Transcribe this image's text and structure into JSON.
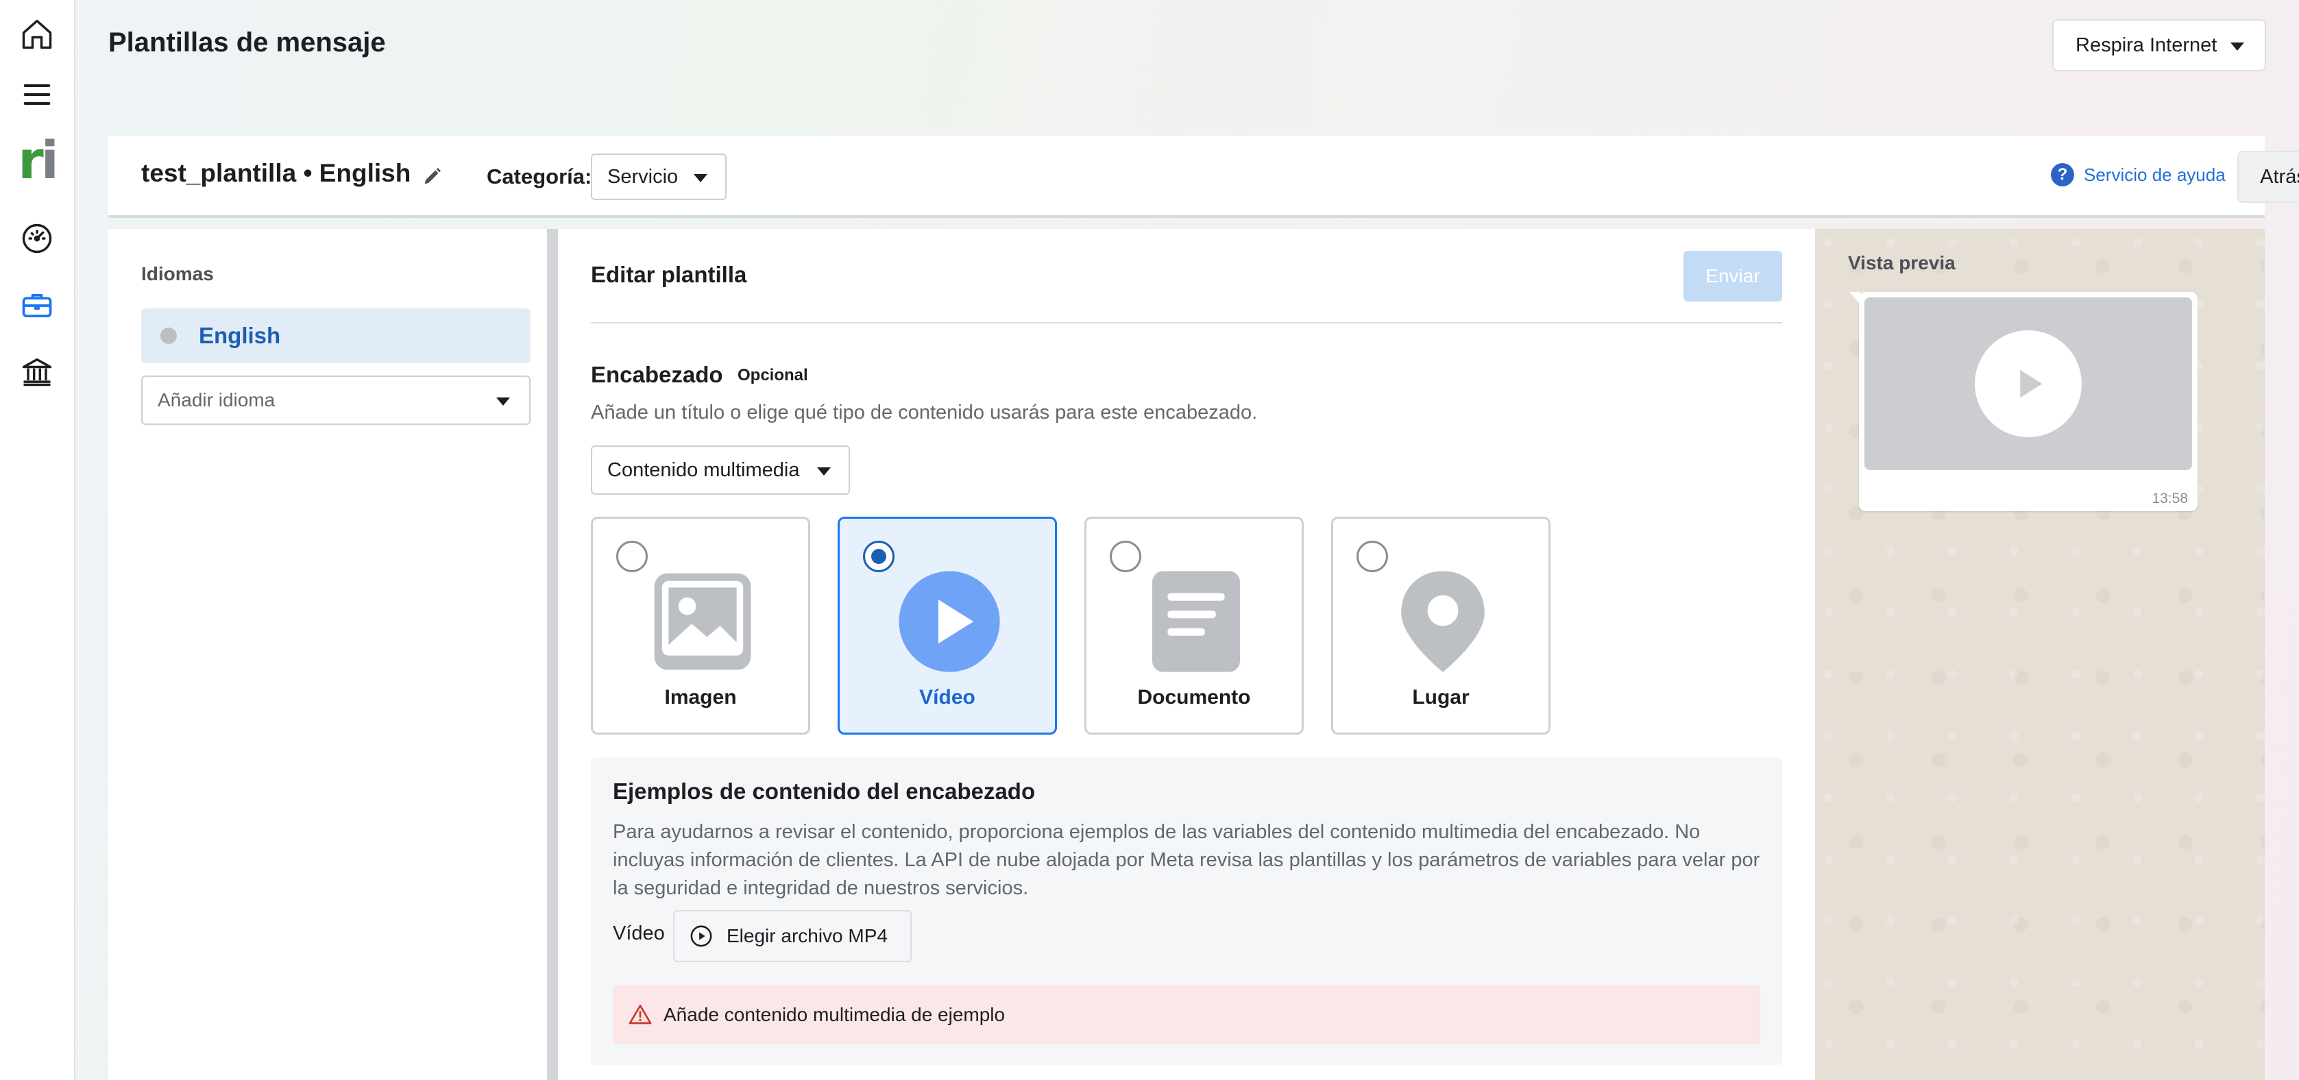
{
  "page": {
    "title": "Plantillas de mensaje",
    "account": "Respira Internet"
  },
  "sidebar": {
    "icons": [
      "home-icon",
      "menu-icon",
      "brand-logo",
      "dashboard-icon",
      "briefcase-icon",
      "bank-icon"
    ],
    "logo_text": "ri"
  },
  "template": {
    "name": "test_plantilla • English",
    "category_label": "Categoría:",
    "category_value": "Servicio",
    "help_label": "Servicio de ayuda",
    "back_label": "Atrás"
  },
  "languages": {
    "title": "Idiomas",
    "items": [
      {
        "label": "English"
      }
    ],
    "add_placeholder": "Añadir idioma"
  },
  "editor": {
    "title": "Editar plantilla",
    "send_label": "Enviar",
    "header": {
      "title": "Encabezado",
      "optional_badge": "Opcional",
      "description": "Añade un título o elige qué tipo de contenido usarás para este encabezado.",
      "type_value": "Contenido multimedia",
      "options": [
        {
          "label": "Imagen",
          "selected": false
        },
        {
          "label": "Vídeo",
          "selected": true
        },
        {
          "label": "Documento",
          "selected": false
        },
        {
          "label": "Lugar",
          "selected": false
        }
      ]
    },
    "examples": {
      "title": "Ejemplos de contenido del encabezado",
      "text": "Para ayudarnos a revisar el contenido, proporciona ejemplos de las variables del contenido multimedia del encabezado. No incluyas información de clientes. La API de nube alojada por Meta revisa las plantillas y los parámetros de variables para velar por la seguridad e integridad de nuestros servicios.",
      "video_label": "Vídeo",
      "choose_button": "Elegir archivo MP4",
      "warning": "Añade contenido multimedia de ejemplo"
    }
  },
  "preview": {
    "title": "Vista previa",
    "time": "13:58"
  },
  "colors": {
    "accent": "#1877f2",
    "selected_text": "#1b67cf",
    "send_disabled": "#c4dbf6",
    "warning_bg": "#fbe7e8",
    "logo_green": "#3c9a3c"
  }
}
